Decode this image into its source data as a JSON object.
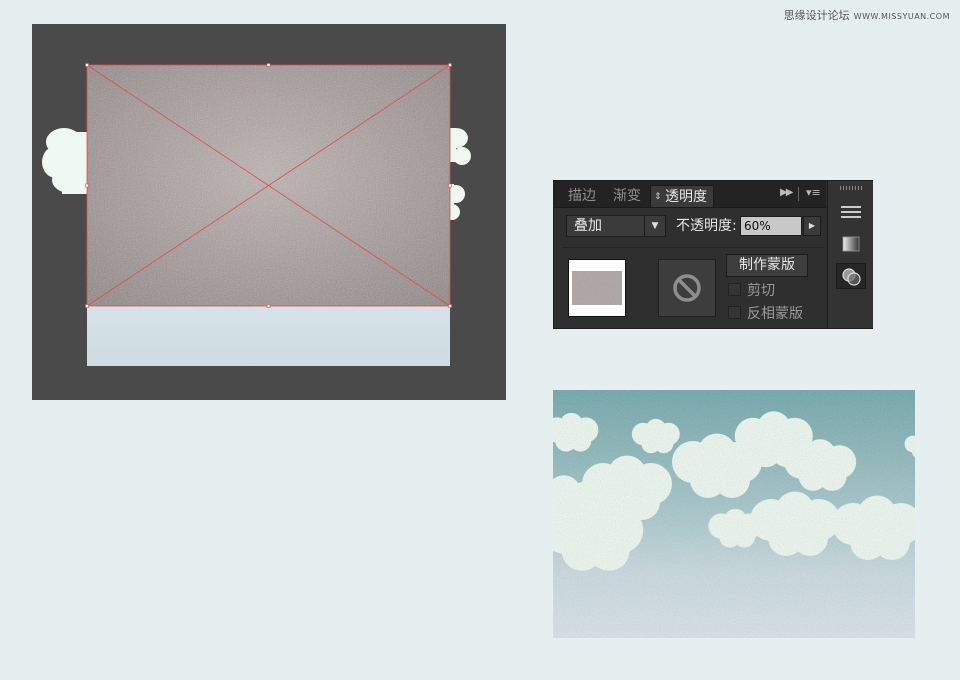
{
  "watermark": {
    "text": "思缘设计论坛",
    "site": "WWW.MISSYUAN.COM"
  },
  "colors": {
    "page_bg": "#e6eff0",
    "artboard_bg": "#4a4a4a",
    "cloud_mint": "#eefaf1",
    "selection_red": "#e24a4a",
    "texture_gray": "#a59c9a",
    "sky_bottom_band": "#d2e0e6",
    "sky_teal": "#6aa3a7"
  },
  "panel": {
    "tabs": [
      {
        "label": "描边",
        "active": false
      },
      {
        "label": "渐变",
        "active": false
      },
      {
        "label": "透明度",
        "active": true
      }
    ],
    "blend_mode": "叠加",
    "opacity_label": "不透明度:",
    "opacity_value": "60%",
    "make_mask_label": "制作蒙版",
    "checkboxes": [
      {
        "label": "剪切",
        "checked": false
      },
      {
        "label": "反相蒙版",
        "checked": false
      }
    ],
    "dock_icons": [
      "menu-lines-icon",
      "gradient-swatch-icon",
      "transparency-circles-icon"
    ]
  }
}
